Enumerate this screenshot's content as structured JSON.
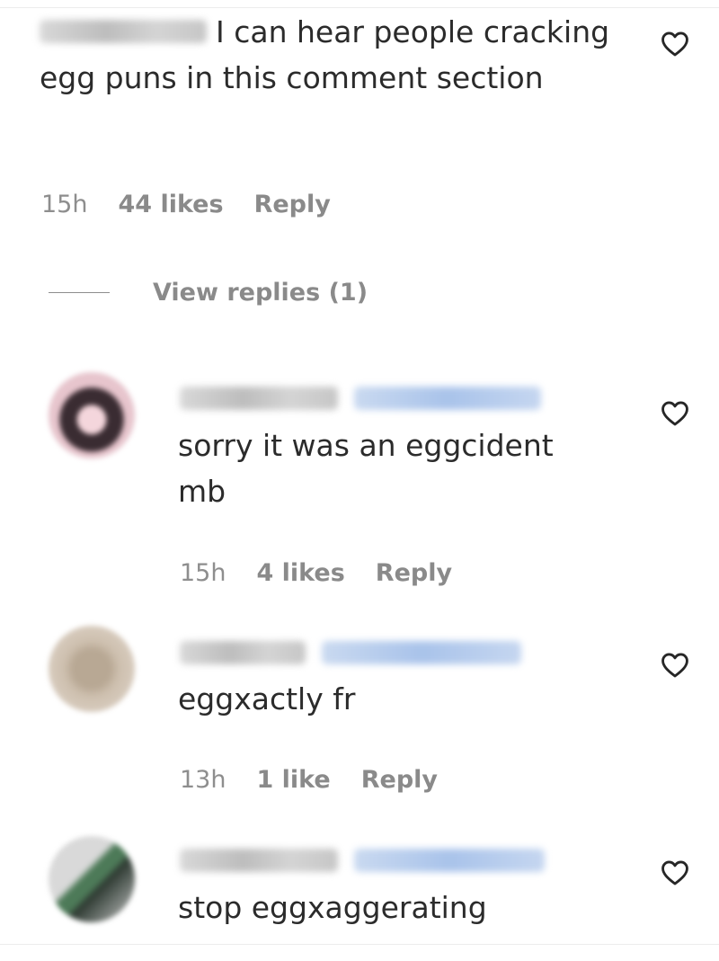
{
  "main_comment": {
    "text": "I can hear people cracking egg puns in this comment section",
    "time": "15h",
    "likes": "44 likes",
    "reply_label": "Reply"
  },
  "view_replies": {
    "label": "View replies (1)"
  },
  "replies": [
    {
      "text": "sorry it was an eggcident mb",
      "time": "15h",
      "likes": "4 likes",
      "reply_label": "Reply"
    },
    {
      "text": "eggxactly fr",
      "time": "13h",
      "likes": "1 like",
      "reply_label": "Reply"
    },
    {
      "text": "stop eggxaggerating"
    }
  ],
  "icons": {
    "like": "heart-icon"
  },
  "colors": {
    "text": "#262626",
    "meta": "#8e8e8e",
    "mention": "#a9c3ea"
  }
}
